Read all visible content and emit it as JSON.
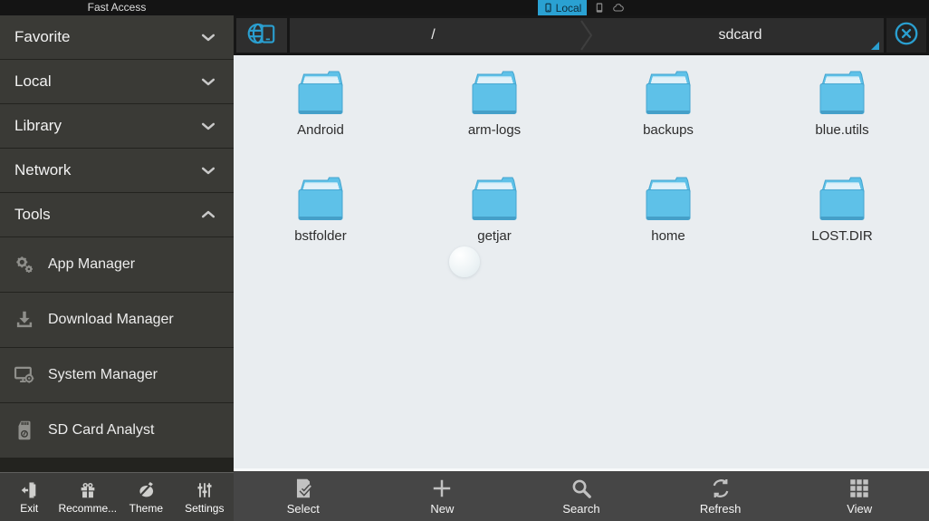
{
  "header": {
    "sidebar_title": "Fast Access",
    "active_tab": {
      "label": "Local",
      "icon": "phone-icon"
    },
    "window_icons": [
      {
        "name": "device-icon"
      },
      {
        "name": "cloud-icon"
      }
    ]
  },
  "path_bar": {
    "home_button_icon": "globe-device-icon",
    "segments": [
      {
        "label": "/"
      },
      {
        "label": "sdcard",
        "dropdown": true
      }
    ],
    "close_icon": "close-icon"
  },
  "sidebar": {
    "groups": [
      {
        "label": "Favorite",
        "state": "collapsed"
      },
      {
        "label": "Local",
        "state": "collapsed"
      },
      {
        "label": "Library",
        "state": "collapsed"
      },
      {
        "label": "Network",
        "state": "collapsed"
      },
      {
        "label": "Tools",
        "state": "expanded"
      }
    ],
    "tools_items": [
      {
        "label": "App Manager",
        "icon": "gears-icon"
      },
      {
        "label": "Download Manager",
        "icon": "download-icon"
      },
      {
        "label": "System Manager",
        "icon": "system-monitor-icon"
      },
      {
        "label": "SD Card Analyst",
        "icon": "sd-card-icon"
      }
    ],
    "toolbar": [
      {
        "label": "Exit",
        "icon": "exit-icon"
      },
      {
        "label": "Recomme...",
        "icon": "gift-icon"
      },
      {
        "label": "Theme",
        "icon": "palette-icon"
      },
      {
        "label": "Settings",
        "icon": "sliders-icon"
      }
    ]
  },
  "main": {
    "folders": [
      "Android",
      "arm-logs",
      "backups",
      "blue.utils",
      "bstfolder",
      "getjar",
      "home",
      "LOST.DIR"
    ],
    "toolbar": [
      {
        "label": "Select",
        "icon": "select-icon"
      },
      {
        "label": "New",
        "icon": "plus-icon"
      },
      {
        "label": "Search",
        "icon": "search-icon"
      },
      {
        "label": "Refresh",
        "icon": "refresh-icon"
      },
      {
        "label": "View",
        "icon": "grid-icon"
      }
    ]
  },
  "colors": {
    "accent_blue": "#2aa1d2",
    "folder_blue": "#5ec1e8",
    "sidebar_item_bg": "#3a3a36",
    "main_bg": "#e9edf0",
    "toolbar_bg": "#464646"
  }
}
